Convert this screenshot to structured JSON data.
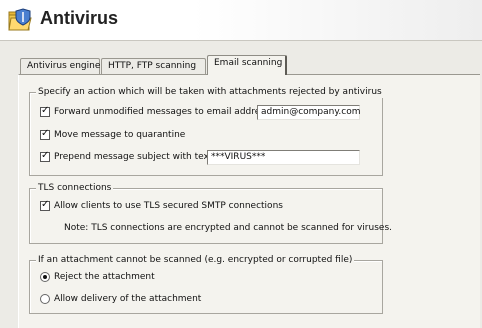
{
  "window": {
    "title": "Antivirus",
    "icon": "folder-shield-icon"
  },
  "tabs": [
    {
      "label": "Antivirus engine",
      "active": false
    },
    {
      "label": "HTTP, FTP scanning",
      "active": false
    },
    {
      "label": "Email scanning",
      "active": true
    }
  ],
  "action_group": {
    "legend": "Specify an action which will be taken with attachments rejected by antivirus",
    "forward": {
      "label": "Forward unmodified messages to email address:",
      "checked": true,
      "value": "admin@company.com"
    },
    "quarantine": {
      "label": "Move message to quarantine",
      "checked": true
    },
    "prepend": {
      "label": "Prepend message subject with text:",
      "checked": true,
      "value": "***VIRUS***"
    }
  },
  "tls_group": {
    "legend": "TLS connections",
    "allow_tls": {
      "label": "Allow clients to use TLS secured SMTP connections",
      "checked": true
    },
    "note": "Note: TLS connections are encrypted and cannot be scanned for viruses."
  },
  "unscannable_group": {
    "legend": "If an attachment cannot be scanned (e.g. encrypted or corrupted file)",
    "options": [
      {
        "label": "Reject the attachment",
        "selected": true
      },
      {
        "label": "Allow delivery of the attachment",
        "selected": false
      }
    ]
  },
  "colors": {
    "background": "#ecebe6",
    "panel": "#f4f3ee",
    "border": "#a8a69f"
  }
}
